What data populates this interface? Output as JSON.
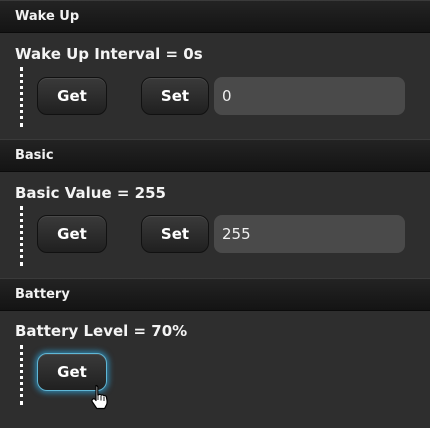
{
  "sections": [
    {
      "header": "Wake Up",
      "title": "Wake Up Interval = 0s",
      "get_label": "Get",
      "set_label": "Set",
      "field_value": "0"
    },
    {
      "header": "Basic",
      "title": "Basic Value = 255",
      "get_label": "Get",
      "set_label": "Set",
      "field_value": "255"
    },
    {
      "header": "Battery",
      "title": "Battery Level = 70%",
      "get_label": "Get"
    }
  ],
  "icons": {
    "cursor": "hand-pointer-icon"
  }
}
